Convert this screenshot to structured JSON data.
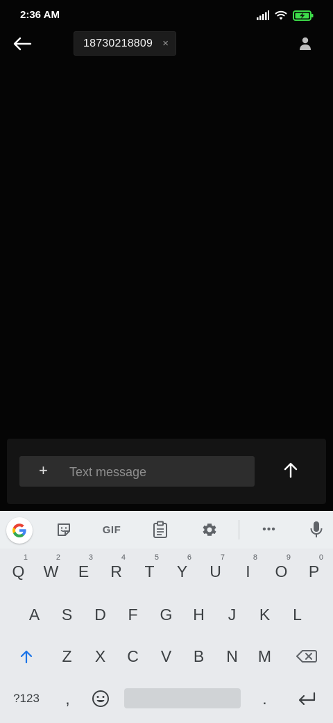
{
  "status": {
    "time": "2:36 AM"
  },
  "header": {
    "recipient": "18730218809",
    "chip_close": "×"
  },
  "composer": {
    "add_symbol": "+",
    "placeholder": "Text message"
  },
  "keyboard": {
    "toolbar": {
      "gif_label": "GIF",
      "more_label": "•••"
    },
    "row1": [
      {
        "key": "Q",
        "hint": "1"
      },
      {
        "key": "W",
        "hint": "2"
      },
      {
        "key": "E",
        "hint": "3"
      },
      {
        "key": "R",
        "hint": "4"
      },
      {
        "key": "T",
        "hint": "5"
      },
      {
        "key": "Y",
        "hint": "6"
      },
      {
        "key": "U",
        "hint": "7"
      },
      {
        "key": "I",
        "hint": "8"
      },
      {
        "key": "O",
        "hint": "9"
      },
      {
        "key": "P",
        "hint": "0"
      }
    ],
    "row2": [
      "A",
      "S",
      "D",
      "F",
      "G",
      "H",
      "J",
      "K",
      "L"
    ],
    "row3": [
      "Z",
      "X",
      "C",
      "V",
      "B",
      "N",
      "M"
    ],
    "symbols_label": "?123",
    "comma_label": ",",
    "period_label": ".",
    "colors": {
      "shift_accent": "#1a73e8",
      "composer_bg": "#141414",
      "keyboard_bg": "#e8eaed"
    }
  }
}
